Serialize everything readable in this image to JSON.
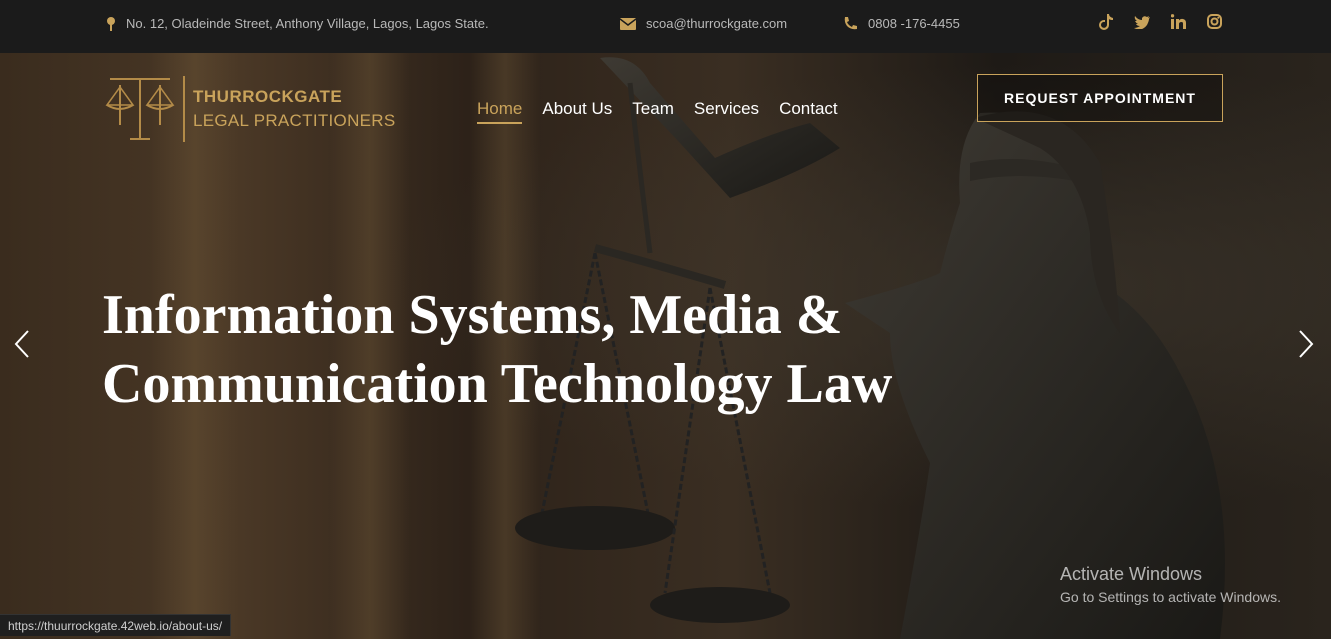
{
  "topbar": {
    "address": "No. 12, Oladeinde Street, Anthony Village, Lagos, Lagos State.",
    "email": "scoa@thurrockgate.com",
    "phone": "0808 -176-4455",
    "social": [
      "tiktok-icon",
      "twitter-icon",
      "linkedin-icon",
      "instagram-icon"
    ]
  },
  "logo": {
    "line1": "THURROCKGATE",
    "line2": "LEGAL PRACTITIONERS"
  },
  "nav": [
    {
      "label": "Home",
      "active": true
    },
    {
      "label": "About Us"
    },
    {
      "label": "Team"
    },
    {
      "label": "Services"
    },
    {
      "label": "Contact"
    }
  ],
  "cta": {
    "label": "REQUEST APPOINTMENT"
  },
  "hero": {
    "line1": "Information Systems, Media &",
    "line2": "Communication Technology Law"
  },
  "windows": {
    "title": "Activate Windows",
    "subtitle": "Go to Settings to activate Windows."
  },
  "status_url": "https://thuurrockgate.42web.io/about-us/",
  "colors": {
    "accent": "#c9a35b",
    "topbar": "#1b1b1b"
  }
}
